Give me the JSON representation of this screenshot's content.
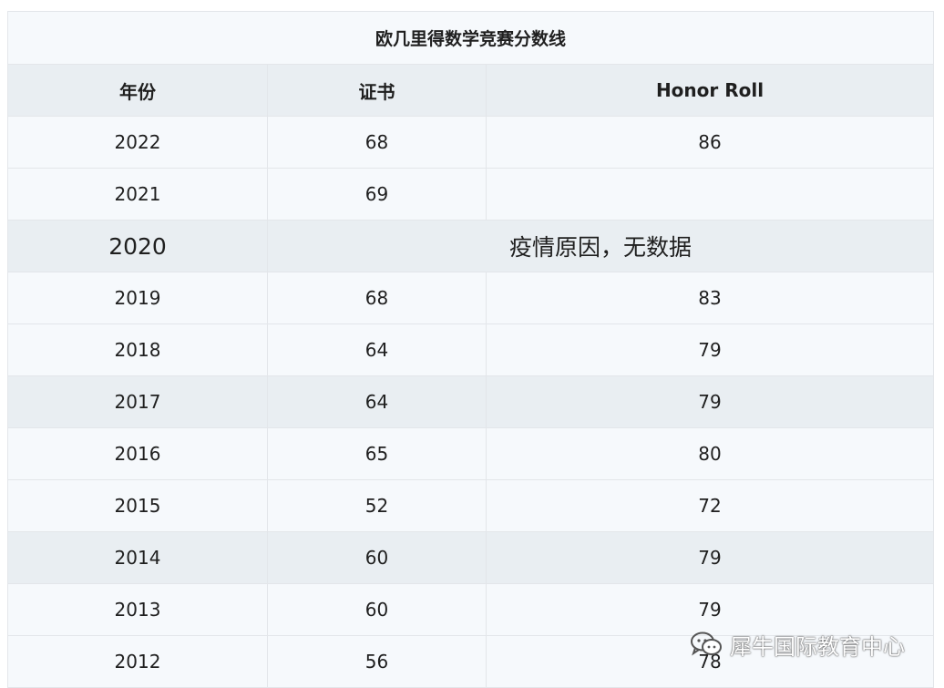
{
  "table": {
    "title": "欧几里得数学竞赛分数线",
    "headers": [
      "年份",
      "证书",
      "Honor Roll"
    ],
    "rows": [
      {
        "year": "2022",
        "certificate": "68",
        "honor_roll": "86"
      },
      {
        "year": "2021",
        "certificate": "69",
        "honor_roll": ""
      },
      {
        "year": "2020",
        "note": "疫情原因，无数据"
      },
      {
        "year": "2019",
        "certificate": "68",
        "honor_roll": "83"
      },
      {
        "year": "2018",
        "certificate": "64",
        "honor_roll": "79"
      },
      {
        "year": "2017",
        "certificate": "64",
        "honor_roll": "79"
      },
      {
        "year": "2016",
        "certificate": "65",
        "honor_roll": "80"
      },
      {
        "year": "2015",
        "certificate": "52",
        "honor_roll": "72"
      },
      {
        "year": "2014",
        "certificate": "60",
        "honor_roll": "79"
      },
      {
        "year": "2013",
        "certificate": "60",
        "honor_roll": "79"
      },
      {
        "year": "2012",
        "certificate": "56",
        "honor_roll": "78"
      }
    ]
  },
  "watermark": {
    "text": "犀牛国际教育中心",
    "icon": "wechat-icon"
  },
  "colors": {
    "light_row": "#f6f9fc",
    "dark_row": "#e9eef2",
    "border": "#e3e6ea"
  }
}
